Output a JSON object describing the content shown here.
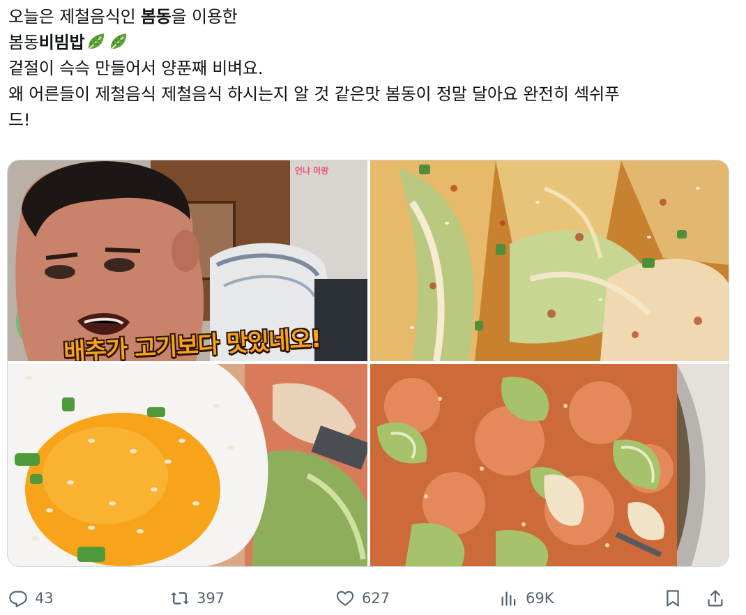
{
  "post": {
    "line1_pre": "오늘은 제철음식인 ",
    "line1_bold": "봄동",
    "line1_post": "을 이용한",
    "line2_pre": "봄동",
    "line2_bold": "비빔밥",
    "line3": "겉절이 슥슥 만들어서 양푼째 비벼요.",
    "line4": "왜 어른들이 제철음식 제철음식 하시는지 알 것 같은맛 봄동이 정말 달아요 완전히 섹쉬푸",
    "line5": "드!"
  },
  "media": {
    "subtitle": "배추가 고기보다 맛있네오!",
    "channel_logo": "언냐 머랑"
  },
  "actions": {
    "replies": "43",
    "retweets": "397",
    "likes": "627",
    "views": "69K"
  },
  "colors": {
    "text": "#0f1419",
    "muted": "#536471",
    "border": "#cfd9de"
  }
}
